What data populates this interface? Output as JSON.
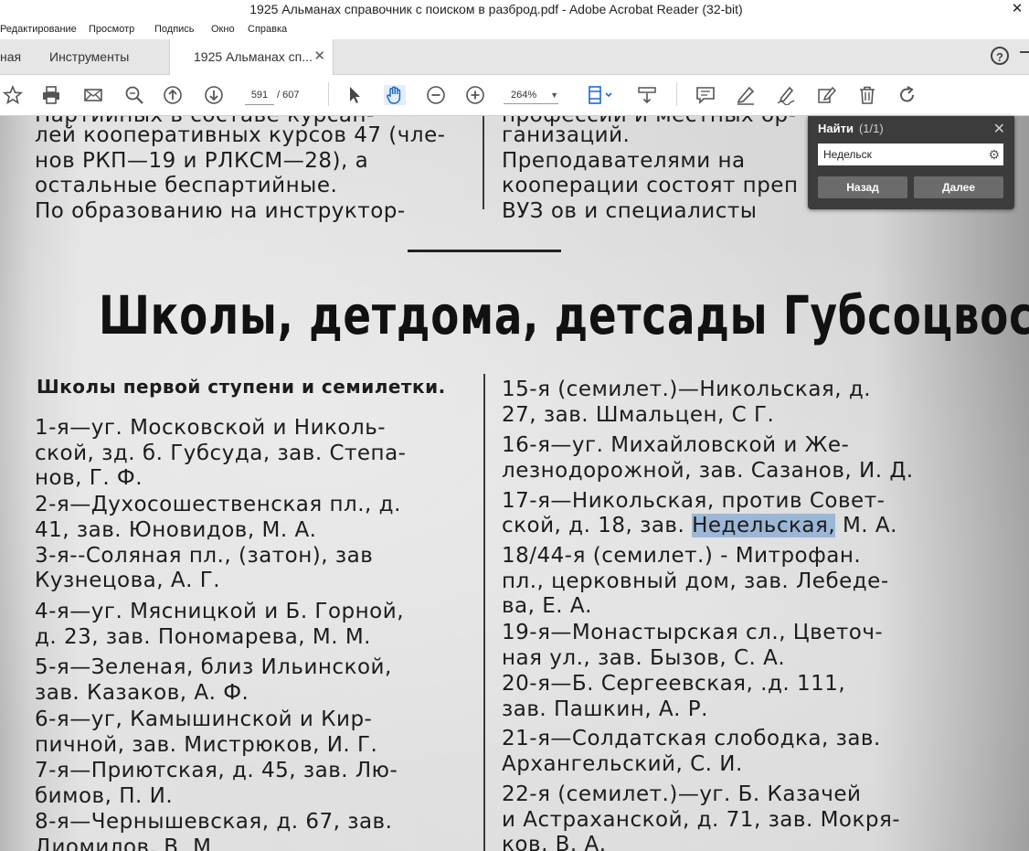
{
  "window": {
    "title": "1925 Альманах справочник с поиском в разброд.pdf - Adobe Acrobat Reader (32-bit)",
    "close": "✕"
  },
  "menu": [
    "Редактирование",
    "Просмотр",
    "Подпись",
    "Окно",
    "Справка"
  ],
  "tabs": {
    "home": "ная",
    "tools": "Инструменты",
    "doc": "1925 Альманах сп...",
    "doc_close": "✕",
    "help": "?"
  },
  "toolbar": {
    "page_current": "591",
    "page_total": "/ 607",
    "zoom": "264%",
    "zoom_caret": "▼"
  },
  "find_panel": {
    "title": "Найти",
    "count": "(1/1)",
    "close": "✕",
    "query": "Недельск",
    "gear": "⚙",
    "prev_label": "Назад",
    "next_label": "Далее"
  },
  "document": {
    "top_left": [
      "Партийных в составе курсан-",
      "лей кооперативных курсов 47 (чле-",
      "нов   РКП—19   и   РЛКСМ—28),   а",
      "остальные беспартийные.",
      "    По образованию на инструктор-"
    ],
    "top_right": [
      "профессий и местных ор-",
      "ганизаций.",
      "    Преподавателями на",
      "кооперации состоят преп",
      "ВУЗ ов и специалисты"
    ],
    "heading": "Школы, детдома, детсады Губсоцвоса.",
    "subheading": "Школы первой ступени и семилетки.",
    "left_col": [
      "    1-я—уг. Московской и  Николь-",
      "ской, зд. б. Губсуда, зав. Степа-",
      "нов, Г. Ф.",
      "    2-я—Духосошественская пл., д.",
      "41, зав. Юновидов, М. А.",
      "    3-я--Соляная пл., (затон), зав",
      "Кузнецова, А. Г.",
      "    4-я—уг. Мясницкой и Б. Горной,",
      "д. 23, зав. Пономарева, М. М.",
      "    5-я—Зеленая,  близ Ильинской,",
      "зав. Казаков, А. Ф.",
      "    6-я—уг, Камышинской и Кир-",
      "пичной, зав. Мистрюков, И. Г.",
      "    7-я—Приютская, д. 45, зав. Лю-",
      "бимов, П. И.",
      "    8-я—Чернышевская, д. 67, зав.",
      "Диомилов, В. М."
    ],
    "right_col": [
      "    15-я  (семилет.)—Никольская,  д.",
      "27, зав. Шмальцен, С Г.",
      "    16-я—уг. Михайловской и Же-",
      "лезнодорожной, зав. Сазанов, И. Д.",
      "    17-я—Никольская, против Совет-",
      "ской, д. 18, зав. ",
      "    18/44-я  (семилет.) - Митрофан.",
      "пл., церковный дом, зав. Лебеде-",
      "ва, Е. А.",
      "    19-я—Монастырская сл., Цветоч-",
      "ная ул., зав. Бызов, С. А.",
      "    20-я—Б. Сергеевская, .д. 111,",
      "зав. Пашкин, А. Р.",
      "    21-я—Солдатская слободка, зав.",
      "Архангельский, С. И.",
      "    22-я  (семилет.)—уг. Б. Казачей",
      "и Астраханской, д. 71, зав. Мокря-",
      "ков, В. А."
    ],
    "highlight": "Недельская,",
    "after_highlight": " М. А."
  }
}
